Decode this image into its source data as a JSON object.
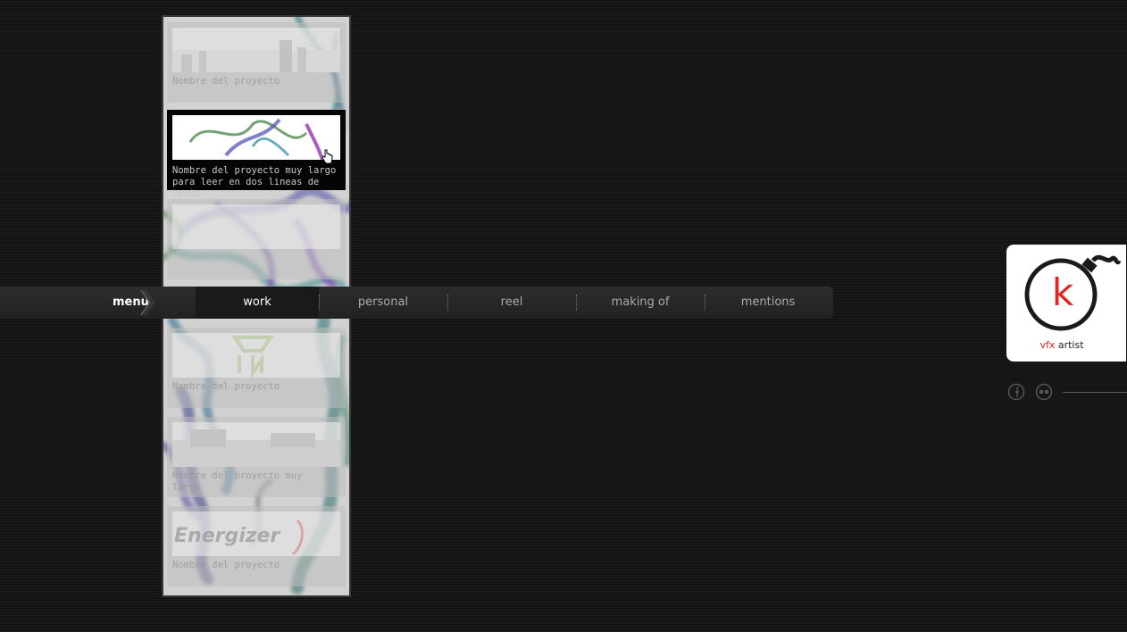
{
  "menu": {
    "label": "menu",
    "items": [
      {
        "label": "work",
        "active": true
      },
      {
        "label": "personal",
        "active": false
      },
      {
        "label": "reel",
        "active": false
      },
      {
        "label": "making of",
        "active": false
      },
      {
        "label": "mentions",
        "active": false
      }
    ]
  },
  "projects": [
    {
      "caption": "Nombre del proyecto"
    },
    {
      "caption_line1": "Nombre del proyecto muy largo",
      "caption_line2": "para leer en dos lineas de texto",
      "active": true
    },
    {
      "caption": ""
    },
    {
      "caption": "Nombre del proyecto"
    },
    {
      "caption_line1": "Nombre del proyecto muy",
      "caption_line2": "largo"
    },
    {
      "caption": "Nombre del proyecto",
      "thumb_text": "Energizer"
    }
  ],
  "logo": {
    "letter": "k",
    "sub_red": "vfx",
    "sub_dark": "artist"
  },
  "social": {
    "icons": [
      "facebook-icon",
      "flickr-icon"
    ]
  },
  "colors": {
    "accent": "#e02424",
    "background": "#141414",
    "menubar": "#2a2a2a"
  }
}
